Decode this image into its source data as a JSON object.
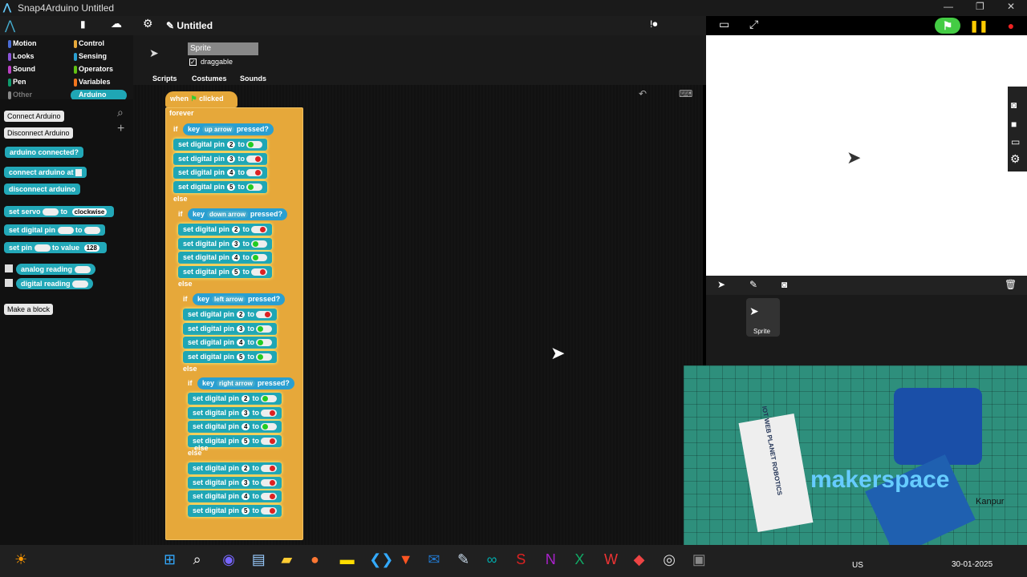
{
  "window": {
    "title": "Snap4Arduino Untitled"
  },
  "toolbar": {
    "project_name": "Untitled"
  },
  "categories": [
    {
      "label": "Motion",
      "color": "#4a6cd4"
    },
    {
      "label": "Control",
      "color": "#e6a83a"
    },
    {
      "label": "Looks",
      "color": "#8a55d7"
    },
    {
      "label": "Sensing",
      "color": "#2a9fd0"
    },
    {
      "label": "Sound",
      "color": "#bb42c3"
    },
    {
      "label": "Operators",
      "color": "#62c213"
    },
    {
      "label": "Pen",
      "color": "#0e9a6c"
    },
    {
      "label": "Variables",
      "color": "#f3761d"
    },
    {
      "label": "Other",
      "color": "#888888"
    },
    {
      "label": "Arduino",
      "color": "#1fa6b5"
    }
  ],
  "palette": {
    "connect_button": "Connect Arduino",
    "disconnect_button": "Disconnect Arduino",
    "b1": "arduino connected?",
    "b2": "connect arduino at",
    "b3": "disconnect arduino",
    "b4": "set servo",
    "b4b": "to",
    "b4dd": "clockwise",
    "b5": "set digital pin",
    "b5b": "to",
    "b6": "set pin",
    "b6b": "to value",
    "b6v": "128",
    "b7": "analog reading",
    "b8": "digital reading",
    "make_block": "Make a block"
  },
  "sprite": {
    "name": "Sprite",
    "draggable_label": "draggable"
  },
  "tabs": [
    "Scripts",
    "Costumes",
    "Sounds"
  ],
  "script": {
    "hat_when": "when",
    "hat_clicked": "clicked",
    "forever": "forever",
    "if": "if",
    "else": "else",
    "key": "key",
    "pressed": "pressed?",
    "set_text": "set digital pin",
    "to": "to",
    "branches": [
      {
        "key": "up arrow",
        "pins": [
          [
            "2",
            true
          ],
          [
            "3",
            false
          ],
          [
            "4",
            false
          ],
          [
            "5",
            true
          ]
        ]
      },
      {
        "key": "down arrow",
        "pins": [
          [
            "2",
            false
          ],
          [
            "3",
            true
          ],
          [
            "4",
            true
          ],
          [
            "5",
            false
          ]
        ]
      },
      {
        "key": "left arrow",
        "pins": [
          [
            "2",
            false
          ],
          [
            "3",
            true
          ],
          [
            "4",
            true
          ],
          [
            "5",
            true
          ]
        ]
      },
      {
        "key": "right arrow",
        "pins": [
          [
            "2",
            true
          ],
          [
            "3",
            false
          ],
          [
            "4",
            true
          ],
          [
            "5",
            false
          ]
        ]
      },
      {
        "key": "",
        "pins": [
          [
            "2",
            false
          ],
          [
            "3",
            false
          ],
          [
            "4",
            false
          ],
          [
            "5",
            false
          ]
        ]
      }
    ]
  },
  "corral": {
    "sprite_label": "Sprite"
  },
  "camera": {
    "logo": "makerspace",
    "city": "Kanpur",
    "card": "IOT WEB PLANET ROBOTICS"
  },
  "taskbar": {
    "lang": "US",
    "date": "30-01-2025"
  }
}
